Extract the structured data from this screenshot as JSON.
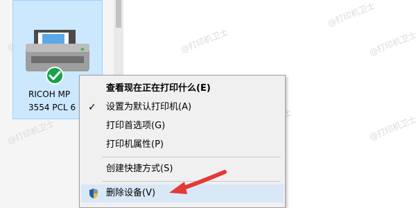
{
  "device": {
    "name_line1": "RICOH MP",
    "name_line2": "3554 PCL 6",
    "status": "default-check",
    "icon": "printer-icon"
  },
  "watermark": "@打印机卫士",
  "menu": {
    "items": [
      {
        "label": "查看现在正在打印什么(E)",
        "bold": true
      },
      {
        "label": "设置为默认打印机(A)",
        "checked": true
      },
      {
        "label": "打印首选项(G)"
      },
      {
        "label": "打印机属性(P)"
      },
      {
        "label": "创建快捷方式(S)"
      },
      {
        "label": "删除设备(V)",
        "icon": "shield-icon",
        "highlighted": true
      }
    ]
  },
  "colors": {
    "selection": "#cce8ff",
    "menu_bg": "#f0f0f0",
    "hover": "#d9e8f7",
    "check_badge": "#16a34a",
    "annotation": "#e53935"
  }
}
